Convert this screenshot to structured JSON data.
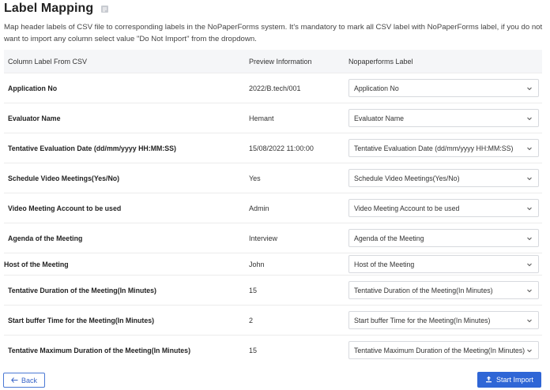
{
  "header": {
    "title": "Label Mapping",
    "description": "Map header labels of CSV file to corresponding labels in the NoPaperForms system. It's mandatory to mark all CSV label with NoPaperForms label, if you do not want to import any column select value \"Do Not Import\" from the dropdown."
  },
  "table": {
    "columns": [
      "Column Label From CSV",
      "Preview Information",
      "Nopaperforms Label"
    ],
    "rows": [
      {
        "label": "Application No",
        "preview": "2022/B.tech/001",
        "mapped": "Application No"
      },
      {
        "label": "Evaluator Name",
        "preview": "Hemant",
        "mapped": "Evaluator Name"
      },
      {
        "label": "Tentative Evaluation Date (dd/mm/yyyy HH:MM:SS)",
        "preview": "15/08/2022 11:00:00",
        "mapped": "Tentative Evaluation Date (dd/mm/yyyy HH:MM:SS)"
      },
      {
        "label": "Schedule Video Meetings(Yes/No)",
        "preview": "Yes",
        "mapped": "Schedule Video Meetings(Yes/No)"
      },
      {
        "label": "Video Meeting Account to be used",
        "preview": "Admin",
        "mapped": "Video Meeting Account to be used"
      },
      {
        "label": "Agenda of the Meeting",
        "preview": "Interview",
        "mapped": "Agenda of the Meeting"
      },
      {
        "label": "Host of the Meeting",
        "preview": "John",
        "mapped": "Host of the Meeting"
      },
      {
        "label": "Tentative Duration of the Meeting(In Minutes)",
        "preview": "15",
        "mapped": "Tentative Duration of the Meeting(In Minutes)"
      },
      {
        "label": "Start buffer Time for the Meeting(In Minutes)",
        "preview": "2",
        "mapped": "Start buffer Time for the Meeting(In Minutes)"
      },
      {
        "label": "Tentative Maximum Duration of the Meeting(In Minutes)",
        "preview": "15",
        "mapped": "Tentative Maximum Duration of the Meeting(In Minutes)"
      }
    ]
  },
  "footer": {
    "back_label": "Back",
    "import_label": "Start Import"
  },
  "icons": {
    "title_icon": "document-icon",
    "chevron": "chevron-down-icon",
    "back": "arrow-left-icon",
    "import": "upload-icon"
  },
  "colors": {
    "primary": "#2f66d6",
    "header_bg": "#f5f6f8"
  }
}
